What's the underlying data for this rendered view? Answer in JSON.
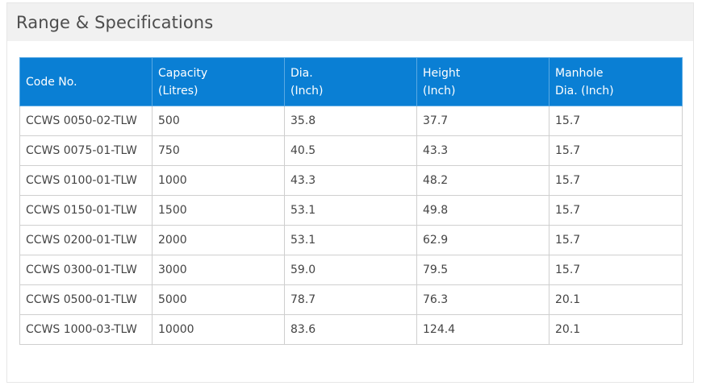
{
  "section": {
    "title": "Range & Specifications"
  },
  "table": {
    "headers": [
      {
        "line1": "Code No.",
        "line2": ""
      },
      {
        "line1": "Capacity",
        "line2": "(Litres)"
      },
      {
        "line1": "Dia.",
        "line2": "(Inch)"
      },
      {
        "line1": "Height",
        "line2": "(Inch)"
      },
      {
        "line1": "Manhole",
        "line2": "Dia. (Inch)"
      }
    ],
    "rows": [
      [
        "CCWS 0050-02-TLW",
        "500",
        "35.8",
        "37.7",
        "15.7"
      ],
      [
        "CCWS 0075-01-TLW",
        "750",
        "40.5",
        "43.3",
        "15.7"
      ],
      [
        "CCWS 0100-01-TLW",
        "1000",
        "43.3",
        "48.2",
        "15.7"
      ],
      [
        "CCWS 0150-01-TLW",
        "1500",
        "53.1",
        "49.8",
        "15.7"
      ],
      [
        "CCWS 0200-01-TLW",
        "2000",
        "53.1",
        "62.9",
        "15.7"
      ],
      [
        "CCWS 0300-01-TLW",
        "3000",
        "59.0",
        "79.5",
        "15.7"
      ],
      [
        "CCWS 0500-01-TLW",
        "5000",
        "78.7",
        "76.3",
        "20.1"
      ],
      [
        "CCWS 1000-03-TLW",
        "10000",
        "83.6",
        "124.4",
        "20.1"
      ]
    ]
  },
  "colors": {
    "header_bg": "#0a7fd4",
    "panel_header_bg": "#f1f1f1"
  }
}
